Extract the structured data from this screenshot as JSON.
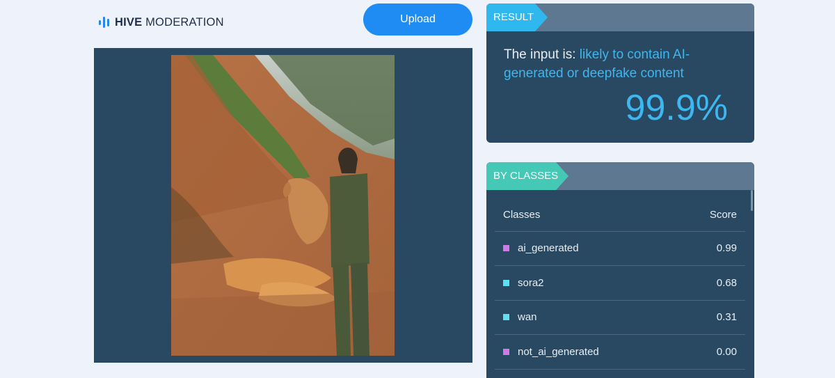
{
  "brand": {
    "name_bold": "HIVE",
    "name_rest": " MODERATION"
  },
  "upload_label": "Upload",
  "result": {
    "tag": "RESULT",
    "prefix": "The input is: ",
    "verdict": "likely to contain AI-generated or deepfake content",
    "percent": "99.9%"
  },
  "classes": {
    "tag": "BY CLASSES",
    "headers": {
      "name": "Classes",
      "score": "Score"
    },
    "rows": [
      {
        "name": "ai_generated",
        "score": "0.99",
        "color": "#d07ae8"
      },
      {
        "name": "sora2",
        "score": "0.68",
        "color": "#5fe0f0"
      },
      {
        "name": "wan",
        "score": "0.31",
        "color": "#5fe0f0"
      },
      {
        "name": "not_ai_generated",
        "score": "0.00",
        "color": "#d07ae8"
      }
    ]
  },
  "colors": {
    "accent": "#1e8cf2",
    "highlight": "#3db7f0",
    "panel": "#294862"
  }
}
